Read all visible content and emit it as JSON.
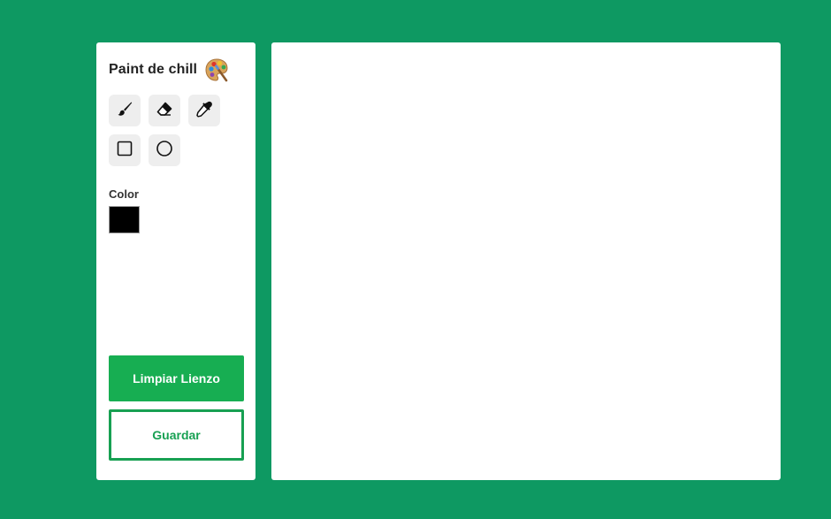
{
  "app": {
    "title": "Paint de chill",
    "title_icon": "palette-icon"
  },
  "tools": [
    {
      "name": "brush",
      "icon": "brush-icon"
    },
    {
      "name": "eraser",
      "icon": "eraser-icon"
    },
    {
      "name": "eyedropper",
      "icon": "eyedropper-icon"
    },
    {
      "name": "rectangle",
      "icon": "square-icon"
    },
    {
      "name": "circle",
      "icon": "circle-icon"
    }
  ],
  "color": {
    "label": "Color",
    "value": "#000000"
  },
  "buttons": {
    "clear_label": "Limpiar Lienzo",
    "save_label": "Guardar"
  },
  "colors": {
    "background": "#0e9962",
    "primary": "#17ae52",
    "outline": "#17a052"
  }
}
